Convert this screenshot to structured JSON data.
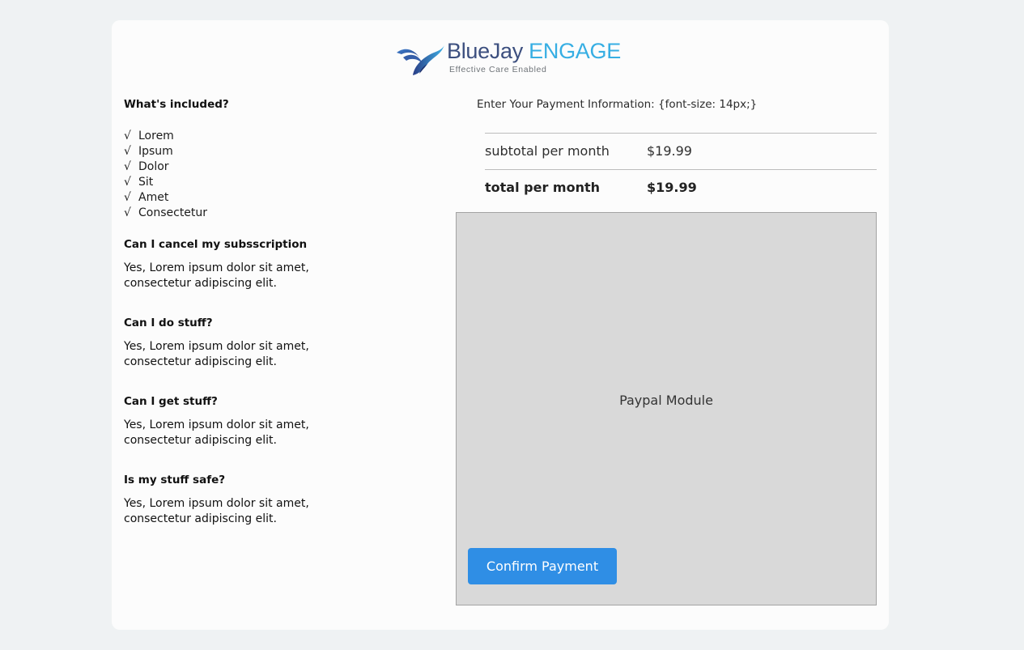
{
  "logo": {
    "brand_part1": "BlueJay",
    "brand_part2": "ENGAGE",
    "tagline": "Effective Care Enabled",
    "icon": "bird-icon",
    "colors": {
      "dark_blue": "#3c4f7f",
      "light_blue": "#36aee3"
    }
  },
  "included": {
    "heading": "What's included?",
    "check_glyph": "√",
    "items": [
      "Lorem",
      "Ipsum",
      "Dolor",
      "Sit",
      "Amet",
      "Consectetur"
    ]
  },
  "faq": [
    {
      "question": "Can I cancel my subsscription",
      "answer": "Yes, Lorem ipsum dolor sit amet, consectetur adipiscing elit."
    },
    {
      "question": "Can I do stuff?",
      "answer": "Yes, Lorem ipsum dolor sit amet, consectetur adipiscing elit."
    },
    {
      "question": "Can I get stuff?",
      "answer": "Yes, Lorem ipsum dolor sit amet, consectetur adipiscing elit."
    },
    {
      "question": "Is my stuff safe?",
      "answer": "Yes, Lorem ipsum dolor sit amet, consectetur adipiscing elit."
    }
  ],
  "payment": {
    "label": "Enter Your Payment Information: {font-size: 14px;}",
    "subtotal_label": "subtotal per month",
    "subtotal_value": "$19.99",
    "total_label": "total per month",
    "total_value": "$19.99",
    "paypal_label": "Paypal Module",
    "confirm_label": "Confirm Payment",
    "button_color": "#2f8ee5"
  }
}
